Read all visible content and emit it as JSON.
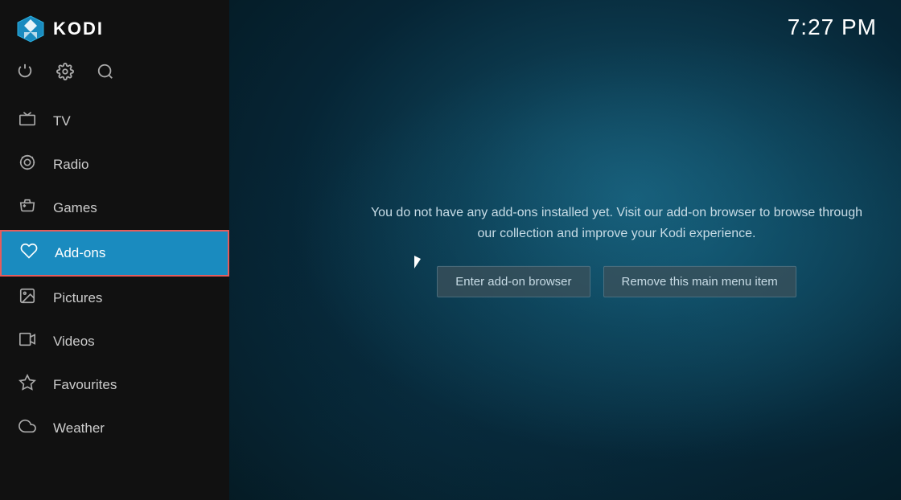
{
  "app": {
    "title": "KODI"
  },
  "clock": {
    "time": "7:27 PM"
  },
  "sidebar": {
    "power_icon": "⏻",
    "settings_icon": "⚙",
    "search_icon": "🔍",
    "nav_items": [
      {
        "id": "tv",
        "label": "TV",
        "icon": "tv",
        "active": false
      },
      {
        "id": "radio",
        "label": "Radio",
        "icon": "radio",
        "active": false
      },
      {
        "id": "games",
        "label": "Games",
        "icon": "games",
        "active": false
      },
      {
        "id": "addons",
        "label": "Add-ons",
        "icon": "addons",
        "active": true
      },
      {
        "id": "pictures",
        "label": "Pictures",
        "icon": "pictures",
        "active": false
      },
      {
        "id": "videos",
        "label": "Videos",
        "icon": "videos",
        "active": false
      },
      {
        "id": "favourites",
        "label": "Favourites",
        "icon": "favourites",
        "active": false
      },
      {
        "id": "weather",
        "label": "Weather",
        "icon": "weather",
        "active": false
      }
    ]
  },
  "main": {
    "message_line1": "You do not have any add-ons installed yet. Visit our add-on browser to browse through",
    "message_line2": "our collection and improve your Kodi experience.",
    "btn_enter_browser": "Enter add-on browser",
    "btn_remove_item": "Remove this main menu item"
  }
}
